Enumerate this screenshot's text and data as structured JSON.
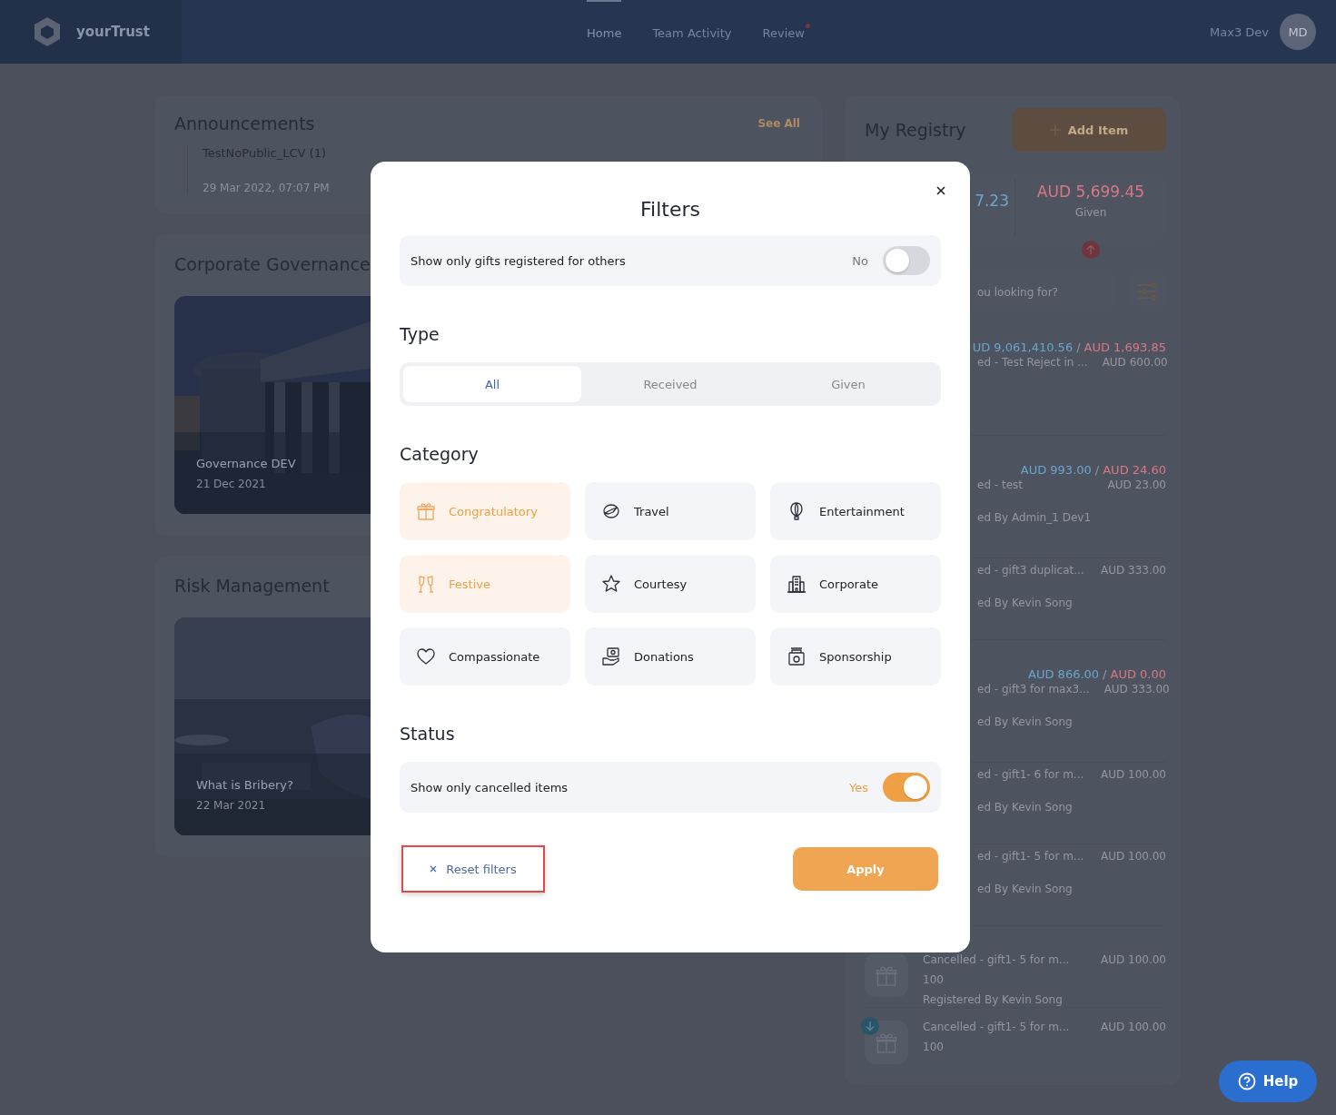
{
  "header": {
    "logo_text": "yourTrust",
    "nav": [
      {
        "label": "Home",
        "selected": true,
        "notification": false
      },
      {
        "label": "Team Activity",
        "selected": false,
        "notification": false
      },
      {
        "label": "Review",
        "selected": false,
        "notification": true
      }
    ],
    "user_name": "Max3 Dev",
    "avatar": "MD"
  },
  "announcements": {
    "title": "Announcements",
    "see_all": "See All",
    "items": [
      {
        "title": "TestNoPublic_LCV (1)",
        "date": "29 Mar 2022, 07:07 PM"
      }
    ]
  },
  "sections": [
    {
      "title": "Corporate Governance",
      "card": {
        "kind": "building",
        "title": "Governance DEV",
        "date": "21 Dec 2021"
      }
    },
    {
      "title": "Risk Management",
      "card": {
        "kind": "desk",
        "title": "What is Bribery?",
        "date": "22 Mar 2021"
      }
    }
  ],
  "registry": {
    "title": "My Registry",
    "add_button": "Add Item",
    "received_amount": "7.23",
    "given_amount": "AUD 5,699.45",
    "given_label": "Given",
    "search_placeholder": "ou looking for?",
    "groups": [
      {
        "received": "UD 9,061,410.56",
        "separator": "/",
        "given": "AUD 1,693.85",
        "items": [
          {
            "kind": "clipped",
            "title": "ed - Test Reject in ...",
            "amount": "AUD 600.00"
          }
        ]
      },
      {
        "received": "AUD 993.00",
        "separator": "/",
        "given": "AUD 24.60",
        "items": [
          {
            "kind": "clipped",
            "title": "ed - test",
            "amount": "AUD 23.00",
            "subtitle": "ed By Admin_1 Dev1"
          },
          {
            "kind": "clipped",
            "title": "ed - gift3 duplicat...",
            "amount": "AUD 333.00",
            "subtitle": "ed By Kevin Song"
          }
        ]
      },
      {
        "received": "AUD 866.00",
        "separator": "/",
        "given": "AUD 0.00",
        "items": [
          {
            "kind": "clipped",
            "title": "ed - gift3 for max3...",
            "amount": "AUD 333.00",
            "subtitle": "ed By Kevin Song"
          },
          {
            "kind": "clipped",
            "title": "ed - gift1- 6 for m...",
            "amount": "AUD 100.00",
            "subtitle": "ed By Kevin Song"
          },
          {
            "kind": "clipped",
            "title": "ed - gift1- 5 for m...",
            "amount": "AUD 100.00",
            "subtitle": "ed By Kevin Song"
          },
          {
            "kind": "full",
            "title": "Cancelled - gift1- 5 for m...",
            "amount": "AUD 100.00",
            "quantity": "100",
            "subtitle": "Registered By Kevin Song"
          },
          {
            "kind": "full",
            "title": "Cancelled - gift1- 5 for m...",
            "amount": "AUD 100.00",
            "quantity": "100",
            "given_badge": true
          }
        ]
      }
    ]
  },
  "help": "Help",
  "filters": {
    "title": "Filters",
    "others": {
      "label": "Show only gifts registered for others",
      "value": "No",
      "on": false
    },
    "type": {
      "title": "Type",
      "options": [
        {
          "label": "All",
          "selected": true
        },
        {
          "label": "Received",
          "selected": false
        },
        {
          "label": "Given",
          "selected": false
        }
      ]
    },
    "category": {
      "title": "Category",
      "options": [
        {
          "label": "Congratulatory",
          "kind": "gift",
          "selected": true
        },
        {
          "label": "Travel",
          "kind": "plane",
          "selected": false
        },
        {
          "label": "Entertainment",
          "kind": "balloon",
          "selected": false
        },
        {
          "label": "Festive",
          "kind": "glasses",
          "selected": true
        },
        {
          "label": "Courtesy",
          "kind": "star",
          "selected": false
        },
        {
          "label": "Corporate",
          "kind": "building",
          "selected": false
        },
        {
          "label": "Compassionate",
          "kind": "heart",
          "selected": false
        },
        {
          "label": "Donations",
          "kind": "hand",
          "selected": false
        },
        {
          "label": "Sponsorship",
          "kind": "register",
          "selected": false
        }
      ]
    },
    "status": {
      "title": "Status",
      "toggle": {
        "label": "Show only cancelled items",
        "value": "Yes",
        "on": true
      }
    },
    "reset": {
      "label": "Reset filters",
      "highlighted": true
    },
    "apply": "Apply"
  }
}
